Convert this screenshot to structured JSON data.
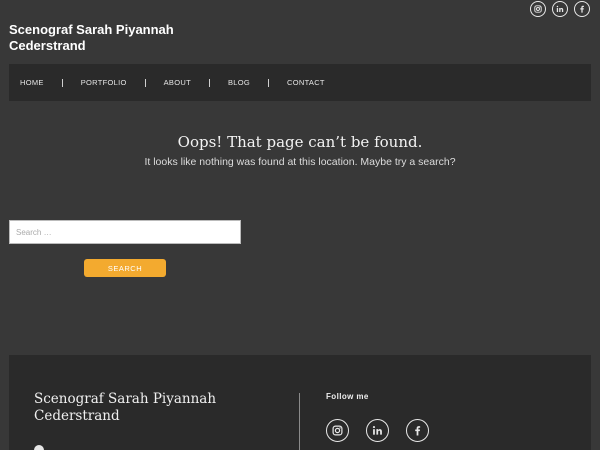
{
  "header": {
    "site_title": "Scenograf Sarah Piyannah Cederstrand",
    "social_icons": [
      "instagram-icon",
      "linkedin-icon",
      "facebook-icon"
    ]
  },
  "nav": {
    "items": [
      {
        "label": "HOME"
      },
      {
        "label": "PORTFOLIO"
      },
      {
        "label": "ABOUT"
      },
      {
        "label": "BLOG"
      },
      {
        "label": "CONTACT"
      }
    ]
  },
  "main": {
    "heading": "Oops! That page can’t be found.",
    "message": "It looks like nothing was found at this location. Maybe try a search?",
    "search": {
      "placeholder": "Search …",
      "value": "",
      "button_label": "SEARCH"
    }
  },
  "footer": {
    "title": "Scenograf Sarah Piyannah Cederstrand",
    "follow_label": "Follow me",
    "social_icons": [
      "instagram-icon",
      "linkedin-icon",
      "facebook-icon"
    ],
    "info_text": ""
  },
  "colors": {
    "background": "#383838",
    "nav_background": "#2a2a2a",
    "footer_background": "#2a2a2a",
    "accent": "#f3aa2f",
    "text": "#ffffff"
  }
}
